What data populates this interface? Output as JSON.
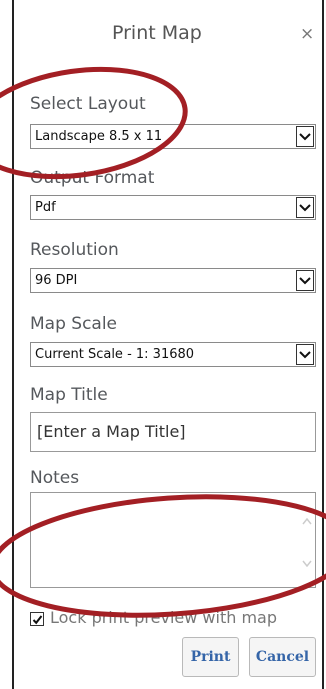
{
  "dialog": {
    "title": "Print Map",
    "close_symbol": "×"
  },
  "form": {
    "layout": {
      "label": "Select Layout",
      "value": "Landscape 8.5 x 11"
    },
    "format": {
      "label": "Output Format",
      "value": "Pdf"
    },
    "resolution": {
      "label": "Resolution",
      "value": "96 DPI"
    },
    "scale": {
      "label": "Map Scale",
      "value": "Current Scale - 1: 31680"
    },
    "map_title": {
      "label": "Map Title",
      "placeholder": "[Enter a Map Title]"
    },
    "notes": {
      "label": "Notes",
      "value": ""
    },
    "lock_preview": {
      "label": "Lock print preview with map",
      "checked": true
    }
  },
  "buttons": {
    "print": "Print",
    "cancel": "Cancel"
  },
  "colors": {
    "annotation_red": "#a31f24",
    "button_text": "#3565a8",
    "label_text": "#55585c"
  }
}
